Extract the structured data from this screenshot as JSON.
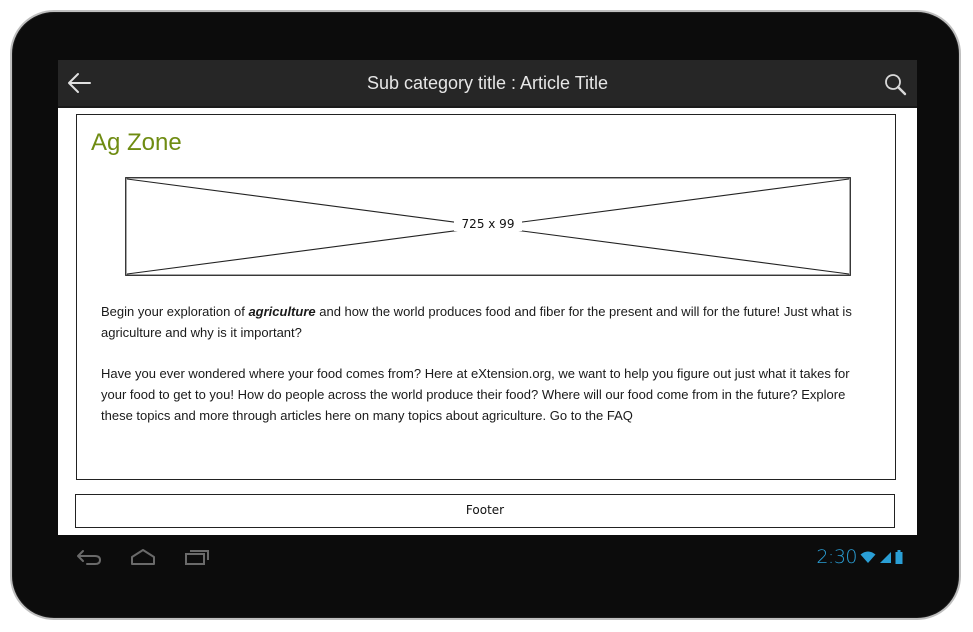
{
  "action_bar": {
    "title": "Sub category title : Article Title"
  },
  "content": {
    "zone_title": "Ag Zone",
    "banner_label": "725 x 99",
    "paragraph1": {
      "before": "Begin your exploration of ",
      "emphasis": "agriculture",
      "after": " and how the world produces food and fiber for the present and will for the future! Just what is agriculture and why is it important?"
    },
    "paragraph2": {
      "text": "Have you ever wondered where your food comes from? Here at eXtension.org, we want to help you figure out just what it takes for your food to get to you! How do people across the world produce their food? Where will our food come from in the future?  Explore these topics and more through articles here on many topics about agriculture. ",
      "link_text": "Go to the FAQ"
    }
  },
  "footer": {
    "label": "Footer"
  },
  "system_bar": {
    "time": "2:30"
  },
  "colors": {
    "accent_green": "#6f8c12",
    "status_blue": "#2a9fd6",
    "action_bar_bg": "#262626"
  }
}
